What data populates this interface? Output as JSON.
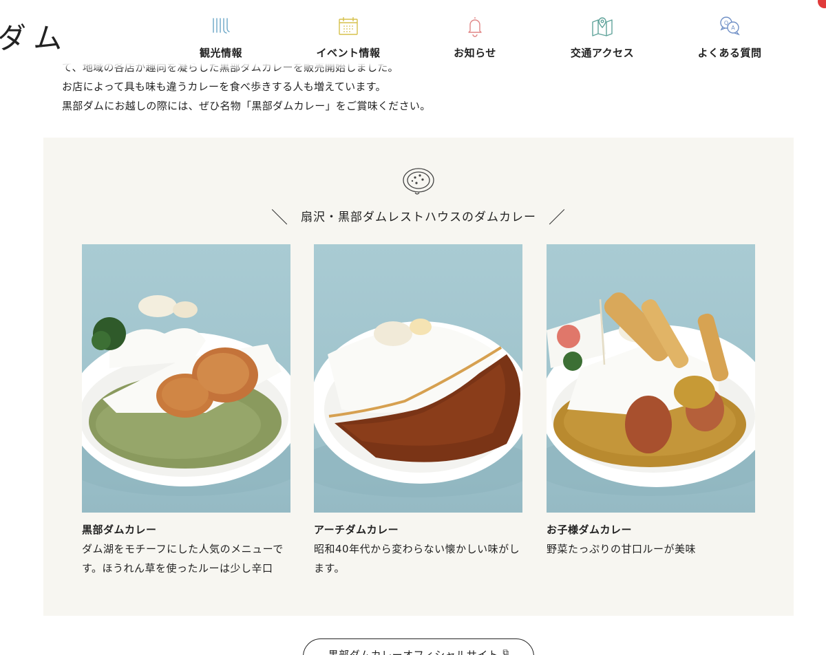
{
  "header": {
    "logo": "ダム",
    "nav": [
      {
        "label": "観光情報",
        "icon": "waterfall-icon",
        "color": "#6aa6c6"
      },
      {
        "label": "イベント情報",
        "icon": "calendar-icon",
        "color": "#d6c04a"
      },
      {
        "label": "お知らせ",
        "icon": "bell-icon",
        "color": "#e08585"
      },
      {
        "label": "交通アクセス",
        "icon": "map-pin-icon",
        "color": "#5fa39a"
      },
      {
        "label": "よくある質問",
        "icon": "qa-bubble-icon",
        "color": "#6f8fc6"
      }
    ]
  },
  "intro": {
    "line1": "て、地域の各店が趣向を凝らした黒部ダムカレーを販売開始しました。",
    "line2": "お店によって具も味も違うカレーを食べ歩きする人も増えています。",
    "line3": "黒部ダムにお越しの際には、ぜひ名物「黒部ダムカレー」をご賞味ください。"
  },
  "section": {
    "icon": "curry-plate-icon",
    "slash_left": "＼",
    "title": "扇沢・黒部ダムレストハウスのダムカレー",
    "slash_right": "／",
    "items": [
      {
        "name": "黒部ダムカレー",
        "desc": "ダム湖をモチーフにした人気のメニューです。ほうれん草を使ったルーは少し辛口"
      },
      {
        "name": "アーチダムカレー",
        "desc": "昭和40年代から変わらない懐かしい味がします。"
      },
      {
        "name": "お子様ダムカレー",
        "desc": "野菜たっぷりの甘口ルーが美味"
      }
    ]
  },
  "official_link": {
    "label": "黒部ダムカレーオフィシャルサイト",
    "icon": "external-link-icon"
  }
}
